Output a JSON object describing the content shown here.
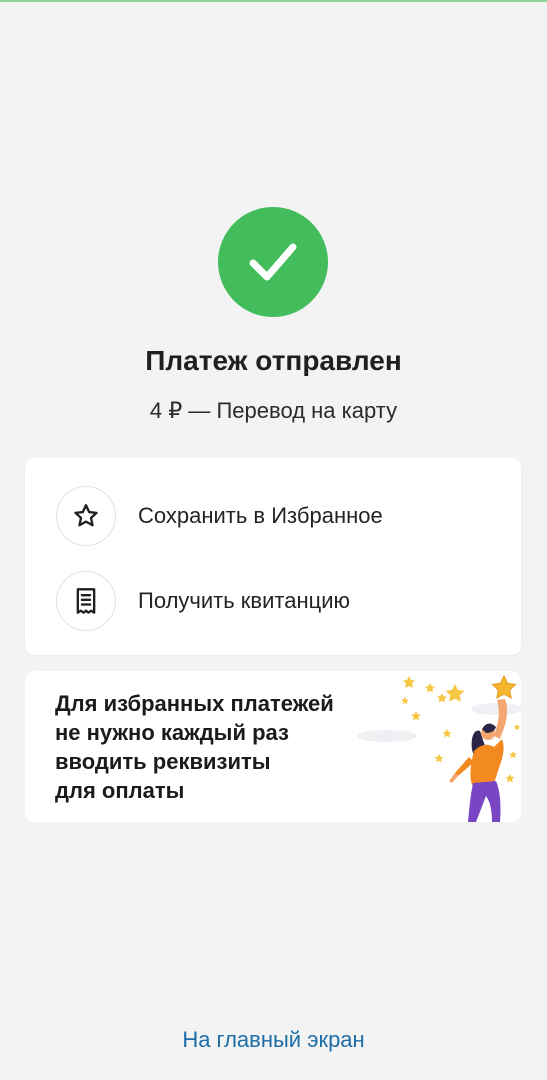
{
  "status": {
    "icon": "checkmark-icon",
    "title": "Платеж отправлен",
    "subtitle": "4 ₽ — Перевод на карту",
    "accent_color": "#43bd5b"
  },
  "actions": [
    {
      "icon": "star-icon",
      "label": "Сохранить в Избранное"
    },
    {
      "icon": "receipt-icon",
      "label": "Получить квитанцию"
    }
  ],
  "promo": {
    "lines": [
      "Для избранных платежей",
      "не нужно каждый раз",
      "вводить реквизиты",
      "для оплаты"
    ],
    "illustration": "woman-reaching-star-illustration"
  },
  "footer": {
    "home_link": "На главный экран",
    "link_color": "#1d6ea8"
  }
}
